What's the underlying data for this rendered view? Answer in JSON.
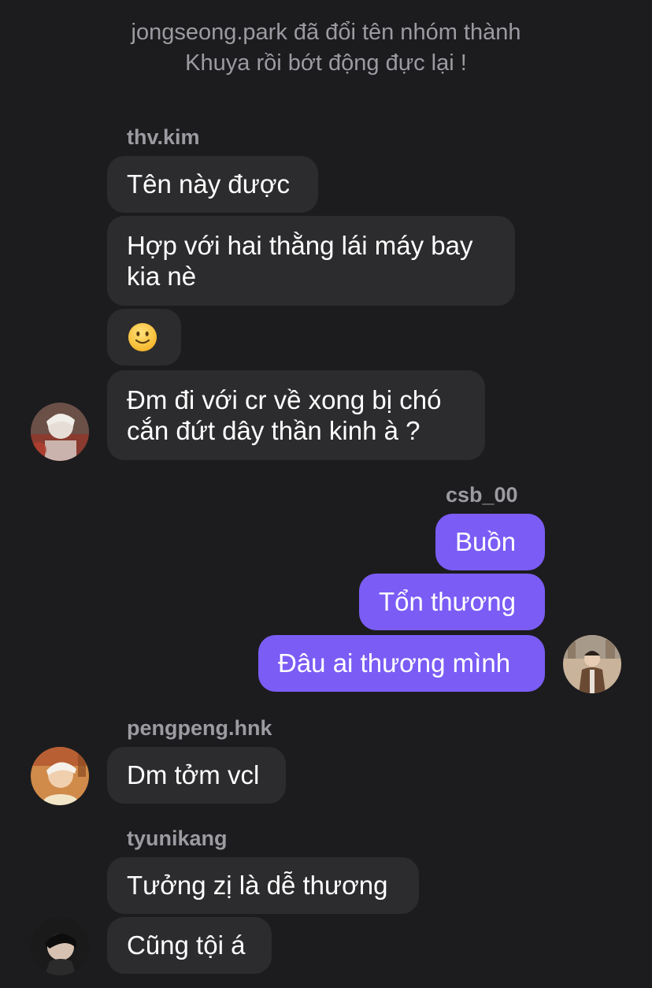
{
  "system_note": {
    "line1": "jongseong.park đã đổi tên nhóm thành",
    "line2": "Khuya rồi bớt động đực lại !"
  },
  "messages": {
    "thv": {
      "sender": "thv.kim",
      "m1": "Tên này được",
      "m2": "Hợp với hai thằng lái máy bay kia nè",
      "m3_emoji": "slightly-smiling-face",
      "m4": "Đm đi với cr về xong bị chó cắn đứt dây thần kinh à ?"
    },
    "csb": {
      "sender": "csb_00",
      "m1": "Buồn",
      "m2": "Tổn thương",
      "m3": "Đâu ai thương mình"
    },
    "peng": {
      "sender": "pengpeng.hnk",
      "m1": "Dm tởm vcl"
    },
    "tyuni": {
      "sender": "tyunikang",
      "m1": "Tưởng zị là dễ thương",
      "m2": "Cũng tội á"
    }
  },
  "colors": {
    "background": "#1c1c1e",
    "incoming_bubble": "#2c2c2e",
    "outgoing_bubble": "#7b5cf5",
    "meta_text": "#9b9ba1"
  }
}
